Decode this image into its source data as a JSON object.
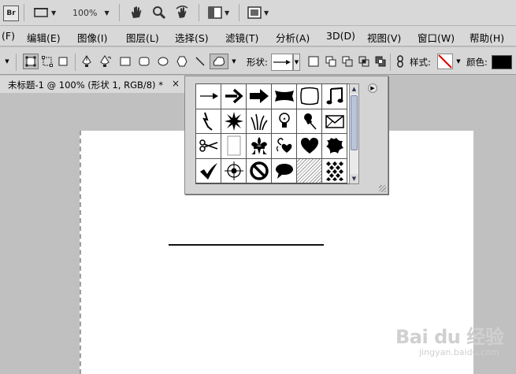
{
  "appbar": {
    "bridge_label": "Br",
    "zoom_value": "100%"
  },
  "menubar": {
    "items": [
      {
        "label": "(F)"
      },
      {
        "label": "编辑(E)"
      },
      {
        "label": "图像(I)"
      },
      {
        "label": "图层(L)"
      },
      {
        "label": "选择(S)"
      },
      {
        "label": "滤镜(T)"
      },
      {
        "label": "分析(A)"
      },
      {
        "label": "3D(D)"
      },
      {
        "label": "视图(V)"
      },
      {
        "label": "窗口(W)"
      },
      {
        "label": "帮助(H)"
      }
    ]
  },
  "options": {
    "shape_label": "形状:",
    "style_label": "样式:",
    "color_label": "颜色:",
    "color_value": "#000000"
  },
  "document": {
    "tab_title": "未标题-1 @ 100% (形状 1, RGB/8) *",
    "close_glyph": "×"
  },
  "shape_popup": {
    "shapes": [
      {
        "name": "arrow-thin"
      },
      {
        "name": "arrow-bold"
      },
      {
        "name": "arrow-block"
      },
      {
        "name": "banner"
      },
      {
        "name": "frame-square"
      },
      {
        "name": "music-note"
      },
      {
        "name": "lightning"
      },
      {
        "name": "starburst"
      },
      {
        "name": "grass"
      },
      {
        "name": "lightbulb"
      },
      {
        "name": "thumbtack"
      },
      {
        "name": "envelope"
      },
      {
        "name": "scissors"
      },
      {
        "name": "paper"
      },
      {
        "name": "fleur-de-lis"
      },
      {
        "name": "heart-ornament"
      },
      {
        "name": "heart"
      },
      {
        "name": "ink-splat"
      },
      {
        "name": "checkmark"
      },
      {
        "name": "crosshair"
      },
      {
        "name": "no-sign"
      },
      {
        "name": "speech-bubble"
      },
      {
        "name": "hatch-pattern"
      },
      {
        "name": "diamond-pattern"
      }
    ]
  },
  "watermark": {
    "main": "Bai du 经验",
    "sub": "jingyan.baidu.com"
  }
}
